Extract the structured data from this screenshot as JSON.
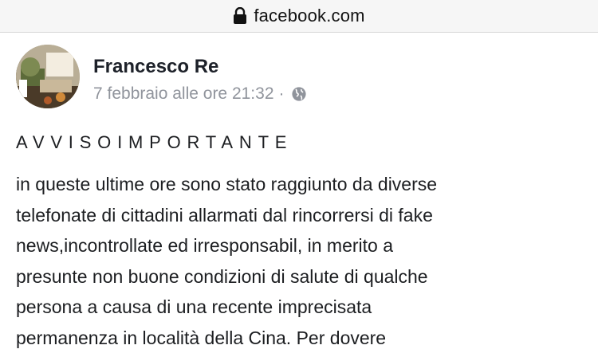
{
  "browser": {
    "domain": "facebook.com"
  },
  "post": {
    "author": "Francesco Re",
    "timestamp": "7 febbraio alle ore 21:32",
    "separator": "·",
    "privacy_icon": "globe-icon",
    "title": "AVVISOIMPORTANTE",
    "lines": [
      "in queste ultime ore sono stato raggiunto da diverse",
      "telefonate di cittadini allarmati dal rincorrersi di fake",
      "news,incontrollate ed irresponsabil, in merito a",
      "presunte non buone condizioni di salute di qualche",
      "persona a causa di una recente imprecisata",
      "permanenza in località della Cina. Per dovere"
    ]
  }
}
